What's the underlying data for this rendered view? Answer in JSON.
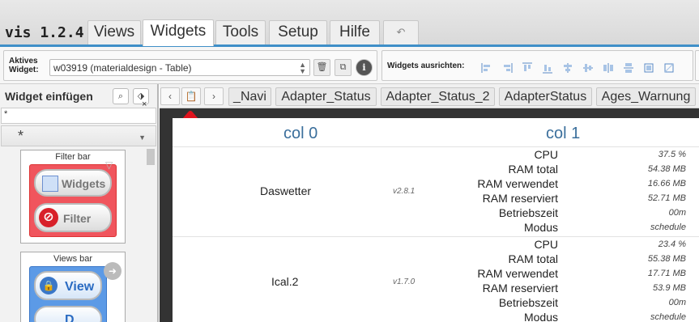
{
  "app": {
    "brand": "vis 1.2.4"
  },
  "tabs": [
    {
      "label": "Views",
      "active": false
    },
    {
      "label": "Widgets",
      "active": true
    },
    {
      "label": "Tools",
      "active": false
    },
    {
      "label": "Setup",
      "active": false
    },
    {
      "label": "Hilfe",
      "active": false
    }
  ],
  "undo_icon": "undo-icon",
  "toolbar": {
    "active_widget_label_1": "Aktives",
    "active_widget_label_2": "Widget:",
    "active_widget_value": "w03919 (materialdesign - Table)",
    "align_label": "Widgets ausrichten:",
    "buttons": [
      "delete-icon",
      "copy-icon",
      "info-icon"
    ],
    "align_icons": [
      "align-left-icon",
      "align-right-icon",
      "align-top-icon",
      "align-bottom-icon",
      "align-center-v-icon",
      "align-center-h-icon",
      "distribute-h-icon",
      "distribute-v-icon",
      "same-width-icon",
      "same-height-icon"
    ]
  },
  "left_panel": {
    "title": "Widget einfügen",
    "filter_value": "*",
    "close": "×",
    "set_value": "*",
    "cards": [
      {
        "title": "Filter bar",
        "pills": [
          "Widgets",
          "Filter"
        ]
      },
      {
        "title": "Views bar",
        "pills": [
          "View",
          "D"
        ]
      }
    ]
  },
  "view_nav": {
    "prev": "‹",
    "next": "›",
    "views": [
      "_Navi",
      "Adapter_Status",
      "Adapter_Status_2",
      "AdapterStatus",
      "Ages_Warnung"
    ]
  },
  "table": {
    "headers": [
      "col 0",
      "col 1"
    ],
    "rows": [
      {
        "name": "Daswetter",
        "version": "v2.8.1",
        "metrics": [
          {
            "label": "CPU",
            "value": "37.5 %"
          },
          {
            "label": "RAM total",
            "value": "54.38 MB"
          },
          {
            "label": "RAM verwendet",
            "value": "16.66 MB"
          },
          {
            "label": "RAM reserviert",
            "value": "52.71 MB"
          },
          {
            "label": "Betriebszeit",
            "value": "00m"
          },
          {
            "label": "Modus",
            "value": "schedule"
          }
        ]
      },
      {
        "name": "Ical.2",
        "version": "v1.7.0",
        "metrics": [
          {
            "label": "CPU",
            "value": "23.4 %"
          },
          {
            "label": "RAM total",
            "value": "55.38 MB"
          },
          {
            "label": "RAM verwendet",
            "value": "17.71 MB"
          },
          {
            "label": "RAM reserviert",
            "value": "53.9 MB"
          },
          {
            "label": "Betriebszeit",
            "value": "00m"
          },
          {
            "label": "Modus",
            "value": "schedule"
          }
        ]
      }
    ]
  },
  "colors": {
    "accent": "#3f8fc8",
    "header_text": "#3b6f9c",
    "annotation_arrow": "#e0141e"
  }
}
